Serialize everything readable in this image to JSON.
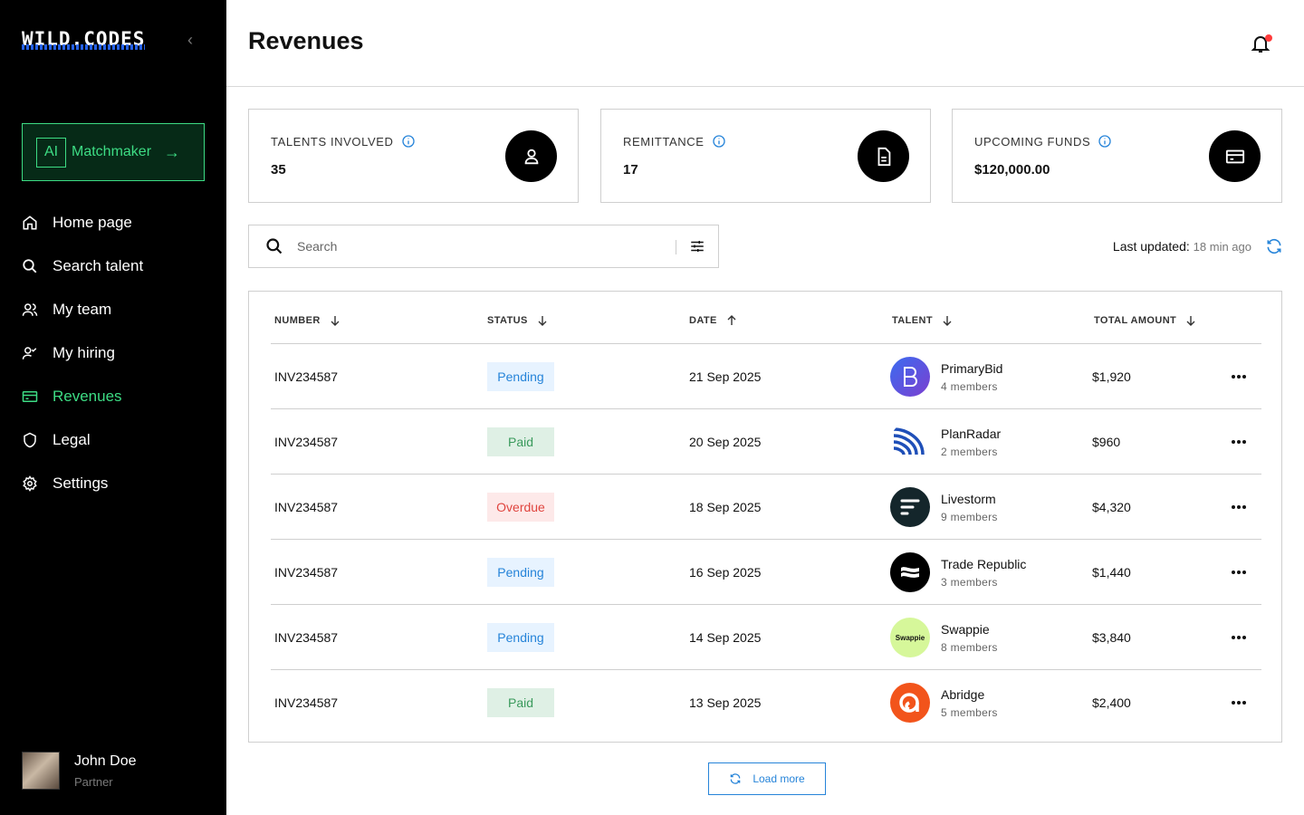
{
  "app": {
    "logo": "WILD.CODES",
    "collapse_icon": "chevron-left-icon"
  },
  "ai_button": {
    "box_label": "AI",
    "label": "Matchmaker",
    "arrow": "→"
  },
  "nav": [
    {
      "label": "Home page",
      "icon": "home-icon",
      "active": false
    },
    {
      "label": "Search talent",
      "icon": "search-icon",
      "active": false
    },
    {
      "label": "My team",
      "icon": "team-icon",
      "active": false
    },
    {
      "label": "My hiring",
      "icon": "hiring-icon",
      "active": false
    },
    {
      "label": "Revenues",
      "icon": "card-icon",
      "active": true
    },
    {
      "label": "Legal",
      "icon": "shield-icon",
      "active": false
    },
    {
      "label": "Settings",
      "icon": "gear-icon",
      "active": false
    }
  ],
  "user": {
    "name": "John Doe",
    "role": "Partner"
  },
  "header": {
    "title": "Revenues",
    "notification_icon": "bell-icon",
    "has_unread": true
  },
  "stats": [
    {
      "label": "TALENTS INVOLVED",
      "value": "35",
      "icon": "user-icon"
    },
    {
      "label": "REMITTANCE",
      "value": "17",
      "icon": "document-icon"
    },
    {
      "label": "UPCOMING FUNDS",
      "value": "$120,000.00",
      "icon": "credit-card-icon"
    }
  ],
  "search": {
    "placeholder": "Search",
    "value": ""
  },
  "last_updated": {
    "label": "Last updated:",
    "value": "18 min ago"
  },
  "table": {
    "columns": [
      {
        "label": "NUMBER",
        "sort": "desc"
      },
      {
        "label": "STATUS",
        "sort": "desc"
      },
      {
        "label": "DATE",
        "sort": "asc"
      },
      {
        "label": "TALENT",
        "sort": "desc"
      },
      {
        "label": "TOTAL AMOUNT",
        "sort": "desc"
      }
    ],
    "rows": [
      {
        "number": "INV234587",
        "status": "Pending",
        "status_type": "pending",
        "date": "21 Sep 2025",
        "talent": "PrimaryBid",
        "members": "4 members",
        "amount": "$1,920"
      },
      {
        "number": "INV234587",
        "status": "Paid",
        "status_type": "paid",
        "date": "20 Sep 2025",
        "talent": "PlanRadar",
        "members": "2 members",
        "amount": "$960"
      },
      {
        "number": "INV234587",
        "status": "Overdue",
        "status_type": "overdue",
        "date": "18 Sep 2025",
        "talent": "Livestorm",
        "members": "9 members",
        "amount": "$4,320"
      },
      {
        "number": "INV234587",
        "status": "Pending",
        "status_type": "pending",
        "date": "16 Sep 2025",
        "talent": "Trade Republic",
        "members": "3 members",
        "amount": "$1,440"
      },
      {
        "number": "INV234587",
        "status": "Pending",
        "status_type": "pending",
        "date": "14 Sep 2025",
        "talent": "Swappie",
        "members": "8 members",
        "amount": "$3,840"
      },
      {
        "number": "INV234587",
        "status": "Paid",
        "status_type": "paid",
        "date": "13 Sep 2025",
        "talent": "Abridge",
        "members": "5 members",
        "amount": "$2,400"
      }
    ]
  },
  "load_more": {
    "label": "Load more"
  },
  "colors": {
    "accent_green": "#3ddc84",
    "accent_blue": "#2684d9",
    "sidebar_bg": "#000000"
  }
}
